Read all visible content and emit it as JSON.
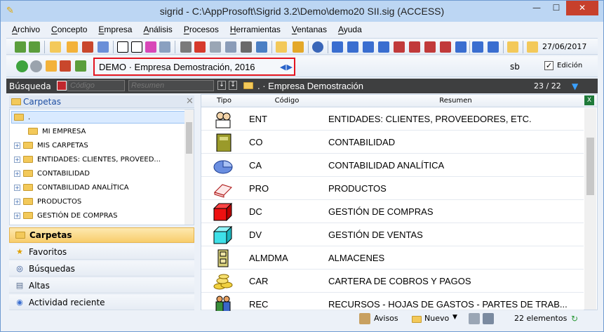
{
  "window": {
    "title": "sigrid - C:\\AppProsoft\\Sigrid 3.2\\Demo\\demo20 SII.sig (ACCESS)"
  },
  "menu": [
    "Archivo",
    "Concepto",
    "Empresa",
    "Análisis",
    "Procesos",
    "Herramientas",
    "Ventanas",
    "Ayuda"
  ],
  "toolbar": {
    "date": "27/06/2017"
  },
  "company_bar": {
    "company": "DEMO · Empresa Demostración, 2016",
    "user": "sb",
    "edit_label": "Edición",
    "edit_checked": "✓"
  },
  "search": {
    "label": "Búsqueda",
    "codigo_placeholder": "Código",
    "resumen_placeholder": "Resumen",
    "path": ". · Empresa Demostración",
    "count": "23 / 22"
  },
  "tree": {
    "header": "Carpetas",
    "root": ".",
    "items": [
      "MI EMPRESA",
      "MIS CARPETAS",
      "ENTIDADES: CLIENTES, PROVEED...",
      "CONTABILIDAD",
      "CONTABILIDAD ANALÍTICA",
      "PRODUCTOS",
      "GESTIÓN DE COMPRAS"
    ]
  },
  "nav_sections": [
    {
      "label": "Carpetas",
      "icon": "folder-icon"
    },
    {
      "label": "Favoritos",
      "icon": "star-icon"
    },
    {
      "label": "Búsquedas",
      "icon": "binoculars-icon"
    },
    {
      "label": "Altas",
      "icon": "form-icon"
    },
    {
      "label": "Actividad reciente",
      "icon": "compass-icon"
    }
  ],
  "grid": {
    "columns": [
      "Tipo",
      "Código",
      "Resumen"
    ],
    "rows": [
      {
        "icon": "people-icon",
        "code": "ENT",
        "summary": "ENTIDADES: CLIENTES, PROVEEDORES, ETC."
      },
      {
        "icon": "ledger-book-icon",
        "code": "CO",
        "summary": "CONTABILIDAD"
      },
      {
        "icon": "pie-chart-icon",
        "code": "CA",
        "summary": "CONTABILIDAD ANALÍTICA"
      },
      {
        "icon": "eraser-icon",
        "code": "PRO",
        "summary": "PRODUCTOS"
      },
      {
        "icon": "red-cube-icon",
        "code": "DC",
        "summary": "GESTIÓN DE COMPRAS"
      },
      {
        "icon": "cyan-cube-icon",
        "code": "DV",
        "summary": "GESTIÓN DE VENTAS"
      },
      {
        "icon": "filing-cabinet-icon",
        "code": "ALMDMA",
        "summary": "ALMACENES"
      },
      {
        "icon": "coins-icon",
        "code": "CAR",
        "summary": "CARTERA DE COBROS Y PAGOS"
      },
      {
        "icon": "people-group-icon",
        "code": "REC",
        "summary": "RECURSOS - HOJAS DE GASTOS - PARTES DE TRAB..."
      }
    ]
  },
  "bottom": {
    "avisos": "Avisos",
    "nuevo": "Nuevo",
    "elements": "22 elementos"
  }
}
